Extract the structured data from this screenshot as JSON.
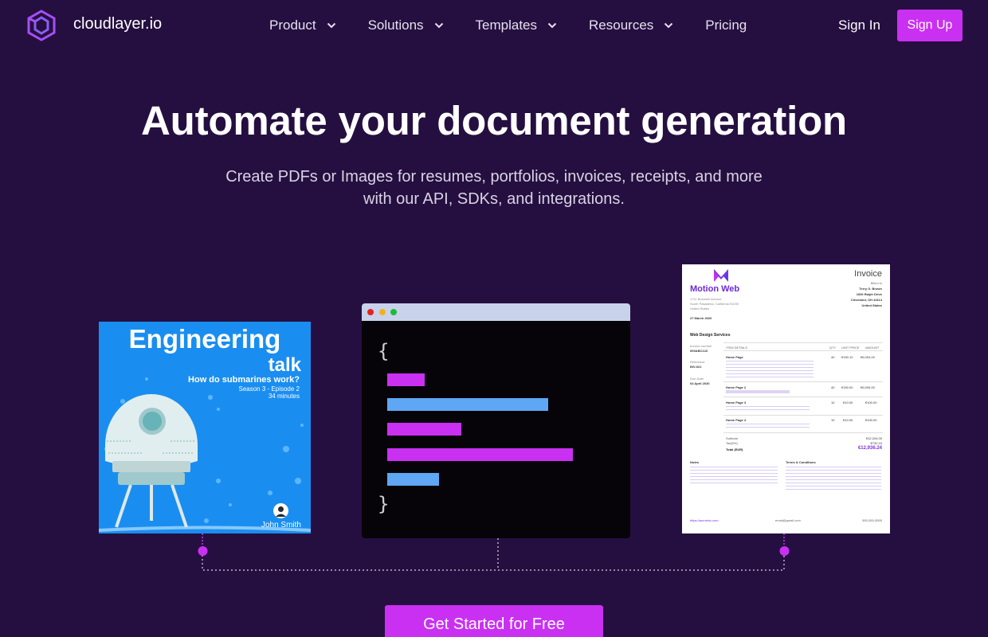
{
  "brand": {
    "name": "cloudlayer.io",
    "accent": "#c930f1",
    "background": "#250f40"
  },
  "nav": {
    "items": [
      {
        "label": "Product",
        "has_dropdown": true
      },
      {
        "label": "Solutions",
        "has_dropdown": true
      },
      {
        "label": "Templates",
        "has_dropdown": true
      },
      {
        "label": "Resources",
        "has_dropdown": true
      },
      {
        "label": "Pricing",
        "has_dropdown": false
      }
    ],
    "sign_in": "Sign In",
    "sign_up": "Sign Up"
  },
  "hero": {
    "title": "Automate your document generation",
    "subtitle_line1": "Create PDFs or Images for resumes, portfolios, invoices, receipts, and more",
    "subtitle_line2": "with our API, SDKs, and integrations.",
    "cta": "Get Started for Free"
  },
  "engineering_card": {
    "title": "Engineering",
    "subtitle": "talk",
    "question": "How do submarines work?",
    "season": "Season 3 - Episode 2",
    "duration": "34 minutes",
    "author": "John Smith"
  },
  "code_card": {
    "open_brace": "{",
    "close_brace": "}",
    "line_colors": [
      "#c930f1",
      "#5fa6f4",
      "#c930f1",
      "#c930f1",
      "#5fa6f4"
    ]
  },
  "invoice_card": {
    "company": "Motion Web",
    "title": "Invoice",
    "billed_to": "Billed to",
    "client_name": "Terry G. Brown",
    "client_addr1": "1600 Ralph Drive",
    "client_addr2": "Cleveland, OH 44114",
    "client_country": "United States",
    "company_addr1": "1711 Bushnell Avenue",
    "company_addr2": "South Pasadena, California 91030",
    "company_country": "United States",
    "date": "27 March 2020",
    "section": "Web Design Services",
    "invoice_number_label": "Invoice number",
    "invoice_number": "000ABC123",
    "reference_label": "Reference",
    "reference": "INV-021",
    "due_label": "Due Date",
    "due_date": "04 April 2020",
    "col_item": "ITEM DETAILS",
    "col_qty": "QTY",
    "col_price": "UNIT PRICE",
    "col_amount": "AMOUNT",
    "rows": [
      {
        "item": "Home Page",
        "qty": "40",
        "price": "€150.10",
        "amount": "€6,004.00"
      },
      {
        "item": "Home Page 2",
        "qty": "40",
        "price": "€150.00",
        "amount": "€6,000.00"
      },
      {
        "item": "Home Page 3",
        "qty": "10",
        "price": "€10.00",
        "amount": "€100.00"
      },
      {
        "item": "Home Page 4",
        "qty": "10",
        "price": "€10.00",
        "amount": "€100.00"
      }
    ],
    "subtotal_label": "Subtotal",
    "subtotal": "€12,204.00",
    "tax_label": "Tax(6%)",
    "tax": "€732.24",
    "total_label": "Total (EUR)",
    "total": "€12,936.24",
    "notes_label": "Notes",
    "terms_label": "Terms & Conditions",
    "website": "https://acmeinc.com",
    "email": "email@gmail.com",
    "phone": "555-555-5555"
  }
}
